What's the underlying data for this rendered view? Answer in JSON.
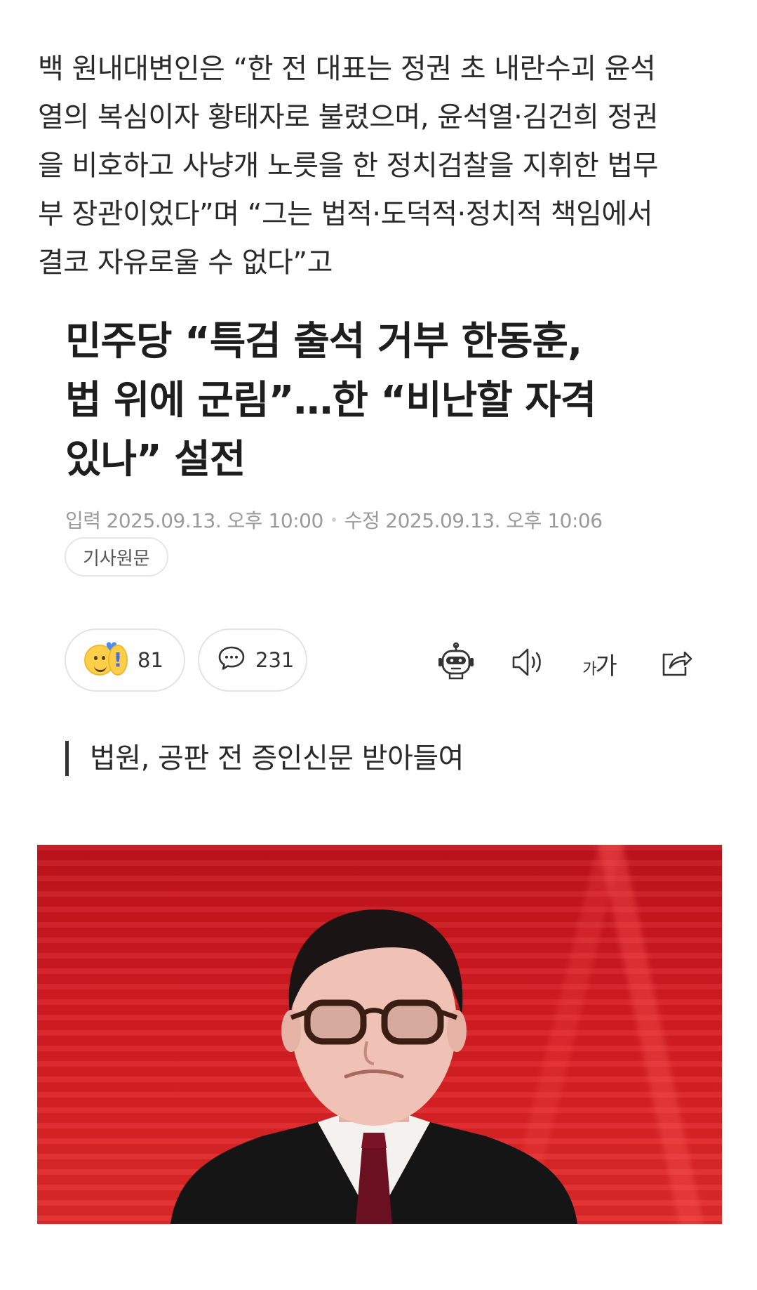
{
  "article": {
    "quote_lines": [
      "백 원내대변인은 “한 전 대표는 정권 초 내란수괴 윤석",
      "열의 복심이자 황태자로 불렸으며, 윤석열·김건희 정권",
      "을 비호하고 사냥개 노릇을 한 정치검찰을 지휘한 법무",
      "부 장관이었다”며 “그는 법적·도덕적·정치적 책임에서",
      "결코 자유로울 수 없다”고"
    ],
    "headline_lines": [
      "민주당 “특검 출석 거부 한동훈,",
      "법 위에 군림”…한 “비난할 자격",
      "있나” 설전"
    ],
    "input_label": "입력",
    "input_date": "2025.09.13. 오후 10:00",
    "edit_label": "수정",
    "edit_date": "2025.09.13. 오후 10:06",
    "origin_button": "기사원문",
    "reaction_count": "81",
    "comment_count": "231",
    "font_size_small": "가",
    "font_size_large": "가",
    "subheading": "법원, 공판 전 증인신문 받아들여"
  },
  "icons": {
    "reaction": "reaction-emoji-icon",
    "comment": "comment-bubble-icon",
    "summary_bot": "robot-icon",
    "listen": "speaker-icon",
    "font_size": "font-size-icon",
    "share": "share-icon"
  },
  "colors": {
    "photo_background": "#d61c22",
    "muted_text": "#9a9a9a"
  }
}
